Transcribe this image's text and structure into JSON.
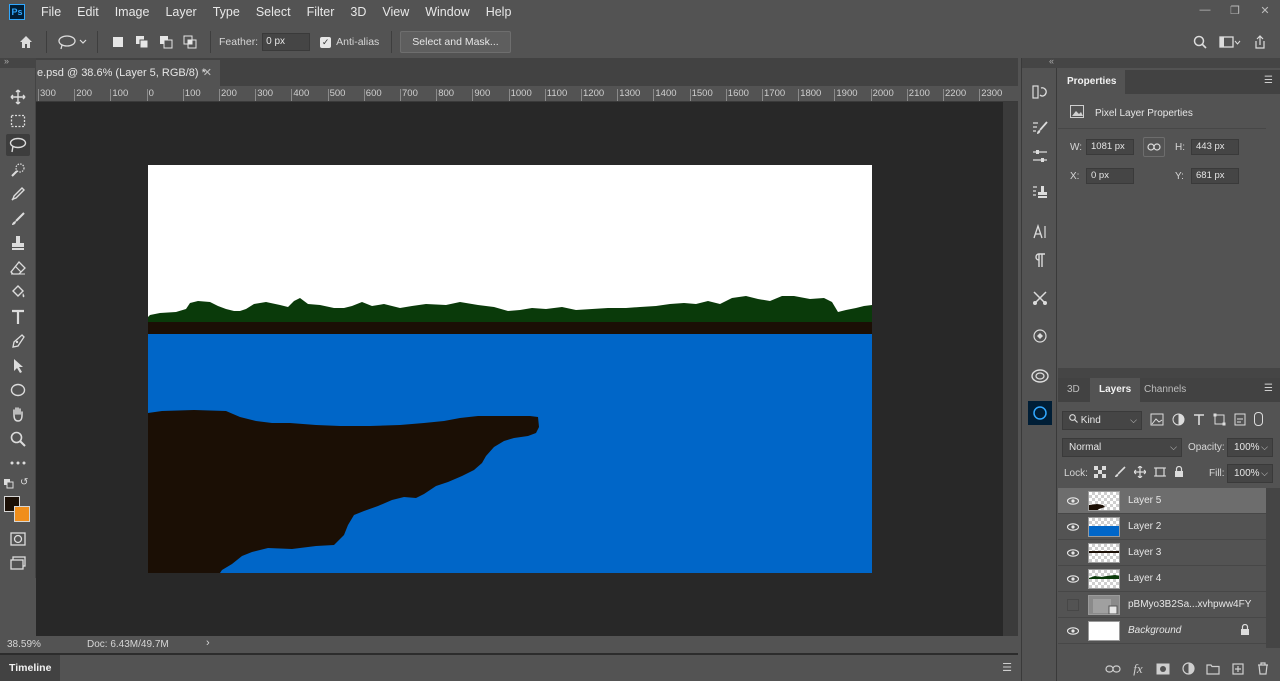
{
  "app": {
    "logo_text": "Ps"
  },
  "menu": [
    "File",
    "Edit",
    "Image",
    "Layer",
    "Type",
    "Select",
    "Filter",
    "3D",
    "View",
    "Window",
    "Help"
  ],
  "options_bar": {
    "feather_label": "Feather:",
    "feather_value": "0 px",
    "antialias_label": "Anti-alias",
    "antialias_checked": true,
    "select_mask_label": "Select and Mask..."
  },
  "document": {
    "tab_title": "e.psd @ 38.6% (Layer 5, RGB/8) *",
    "ruler_ticks": [
      "300",
      "200",
      "100",
      "0",
      "100",
      "200",
      "300",
      "400",
      "500",
      "600",
      "700",
      "800",
      "900",
      "1000",
      "1100",
      "1200",
      "1300",
      "1400",
      "1500",
      "1600",
      "1700",
      "1800",
      "1900",
      "2000",
      "2100",
      "2200",
      "2300"
    ],
    "zoom": "38.59%",
    "doc_info": "Doc: 6.43M/49.7M"
  },
  "colors": {
    "foreground": "#1b0f05",
    "background": "#f08e1b",
    "sky": "#ffffff",
    "water": "#0066c8",
    "trees": "#0a3a0a",
    "land": "#1b0f05"
  },
  "timeline": {
    "label": "Timeline"
  },
  "properties": {
    "tab": "Properties",
    "type": "Pixel Layer Properties",
    "w_label": "W:",
    "w_value": "1081 px",
    "h_label": "H:",
    "h_value": "443 px",
    "x_label": "X:",
    "x_value": "0 px",
    "y_label": "Y:",
    "y_value": "681 px"
  },
  "layers_panel": {
    "tabs": [
      "3D",
      "Layers",
      "Channels"
    ],
    "active_tab": "Layers",
    "kind_label": "Kind",
    "blend_mode": "Normal",
    "opacity_label": "Opacity:",
    "opacity_value": "100%",
    "lock_label": "Lock:",
    "fill_label": "Fill:",
    "fill_value": "100%",
    "layers": [
      {
        "name": "Layer 5",
        "visible": true,
        "selected": true
      },
      {
        "name": "Layer 2",
        "visible": true,
        "selected": false
      },
      {
        "name": "Layer 3",
        "visible": true,
        "selected": false
      },
      {
        "name": "Layer 4",
        "visible": true,
        "selected": false
      },
      {
        "name": "pBMyo3B2Sa...xvhpww4FY",
        "visible": false,
        "selected": false
      },
      {
        "name": "Background",
        "visible": true,
        "selected": false,
        "locked": true
      }
    ]
  }
}
